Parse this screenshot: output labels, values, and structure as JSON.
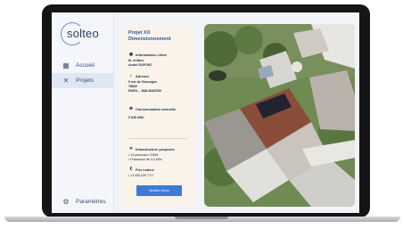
{
  "brand": {
    "name": "solteo"
  },
  "sidebar": {
    "items": [
      {
        "label": "Accueil",
        "icon": "dashboard-icon"
      },
      {
        "label": "Projets",
        "icon": "tools-icon",
        "active": true
      }
    ],
    "settings_label": "Paramètres"
  },
  "project": {
    "title_line1": "Projet XX",
    "title_line2": "Dimensionnement",
    "client": {
      "heading": "Informations client",
      "line1": "M. et Mme",
      "line2": "André DUPONT"
    },
    "address": {
      "heading": "Adresse",
      "line1": "9 rue de Gascogne",
      "line2": "78832",
      "line3": "RUEIL – MALMAISON"
    },
    "consumption": {
      "heading": "Consommation annuelle",
      "value": "5 845 kWh"
    },
    "infrastructure": {
      "heading": "Infrastructure proposée",
      "items": [
        "• 13 panneaux 335W",
        "• Puissance de 4,5 kWc"
      ]
    },
    "price": {
      "heading": "Prix estimé",
      "items": [
        "• 13 955,00€ TTC"
      ]
    },
    "button_label": "Modifier Devis"
  },
  "colors": {
    "accent": "#3e7bd6",
    "card_bg": "#f9f3ea",
    "title": "#2b56a8"
  }
}
